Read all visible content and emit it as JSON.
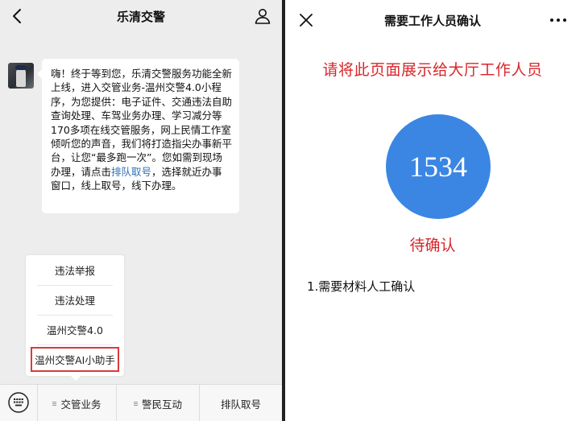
{
  "left": {
    "title": "乐清交警",
    "message": {
      "text_before_link": "嗨！终于等到您，乐清交警服务功能全新上线，进入交管业务-温州交警4.0小程序，为您提供：电子证件、交通违法自助查询处理、车驾业务办理、学习减分等170多项在线交管服务，网上民情工作室倾听您的声音，我们将打造指尖办事新平台，让您“最多跑一次”。您如需到现场办理，请点击",
      "link": "排队取号",
      "text_after_link": "，选择就近办事窗口，线上取号，线下办理。"
    },
    "popup_items": [
      {
        "label": "违法举报"
      },
      {
        "label": "违法处理"
      },
      {
        "label": "温州交警4.0"
      },
      {
        "label": "温州交警AI小助手",
        "highlight_color": "#d93a3a"
      }
    ],
    "menu": [
      {
        "label": "交管业务"
      },
      {
        "label": "警民互动"
      },
      {
        "label": "排队取号"
      }
    ]
  },
  "right": {
    "title": "需要工作人员确认",
    "headline": "请将此页面展示给大厅工作人员",
    "queue_number": "1534",
    "status": "待确认",
    "note": "1.需要材料人工确认"
  },
  "colors": {
    "accent_red": "#d9262a",
    "circle_blue": "#3b86e3",
    "link_blue": "#2f6fb5",
    "chat_bg": "#ededed"
  },
  "icons": [
    "back-arrow-icon",
    "user-icon",
    "keyboard-icon",
    "close-icon",
    "more-icon",
    "menu-dots-icon"
  ]
}
